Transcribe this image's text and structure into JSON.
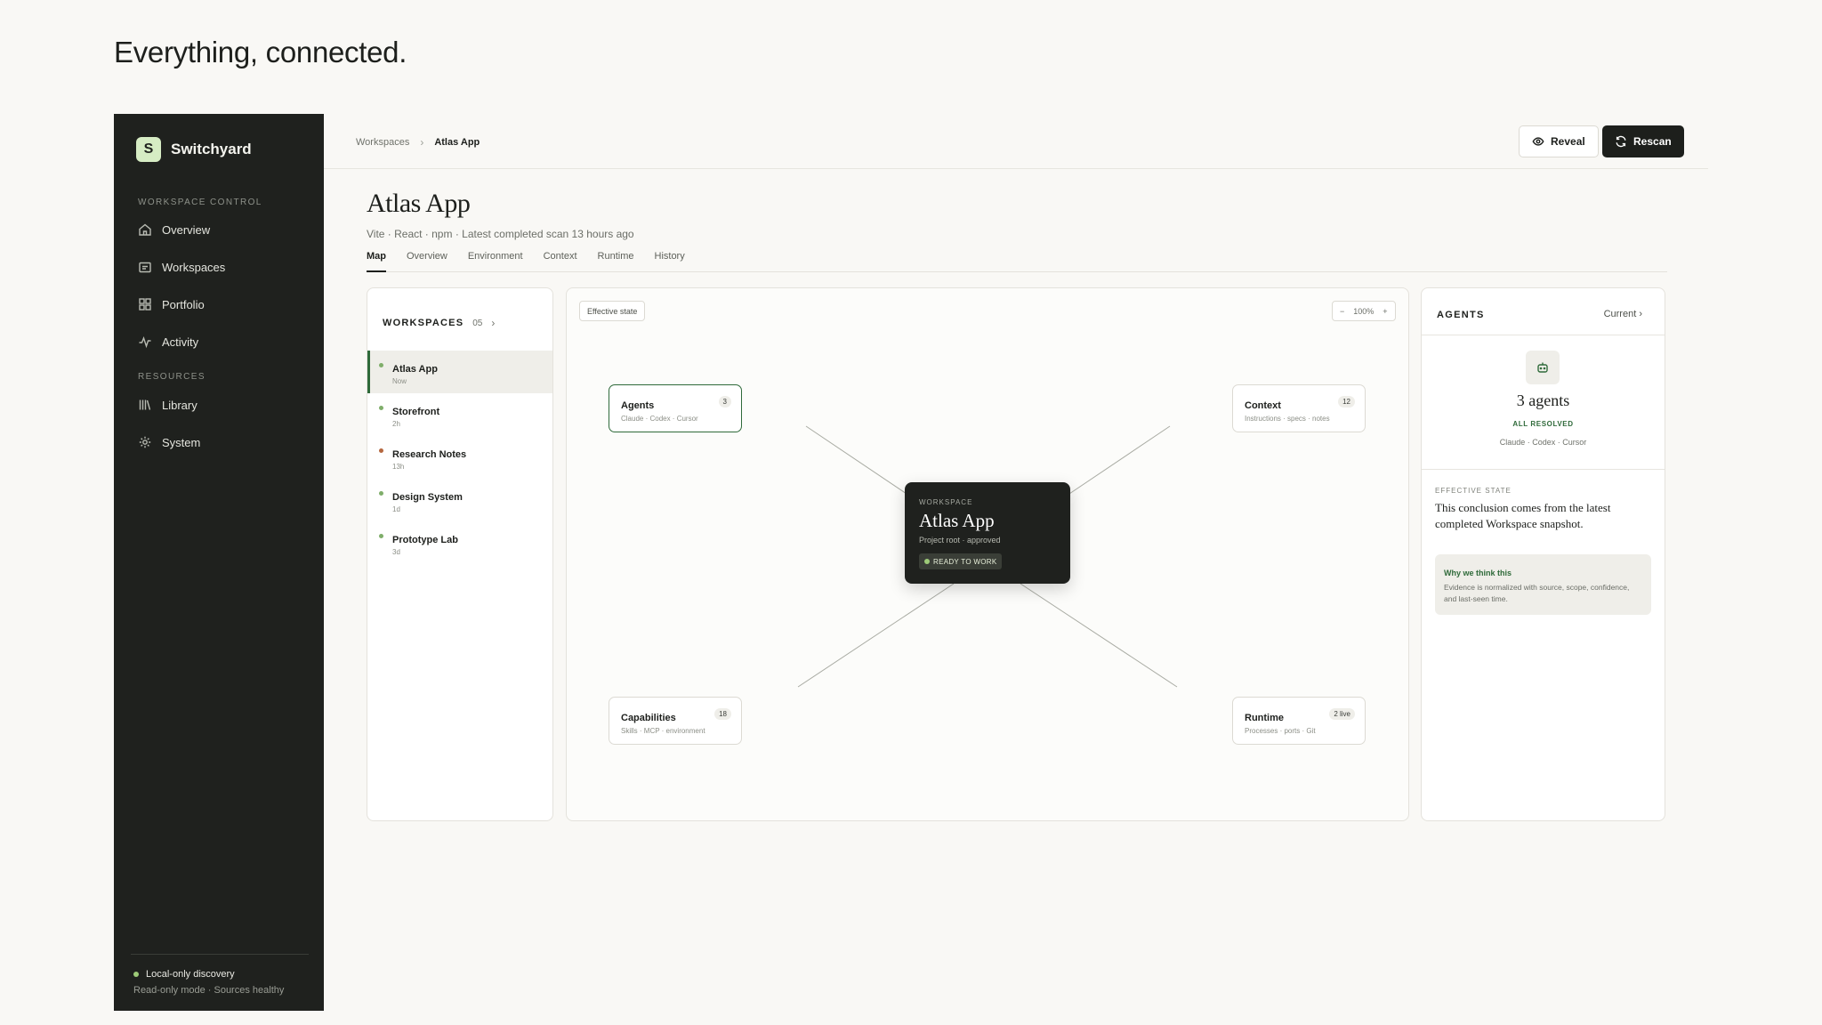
{
  "hero": {
    "title": "Everything, connected."
  },
  "sidebar": {
    "brand": {
      "logo_letter": "S",
      "name": "Switchyard"
    },
    "sections": [
      {
        "label": "WORKSPACE CONTROL",
        "items": [
          {
            "label": "Overview",
            "icon": "home-icon"
          },
          {
            "label": "Workspaces",
            "icon": "folder-icon"
          },
          {
            "label": "Portfolio",
            "icon": "grid-icon"
          },
          {
            "label": "Activity",
            "icon": "activity-icon"
          }
        ]
      },
      {
        "label": "RESOURCES",
        "items": [
          {
            "label": "Library",
            "icon": "library-icon"
          },
          {
            "label": "System",
            "icon": "gear-icon"
          }
        ]
      }
    ],
    "footer": {
      "title": "Local-only discovery",
      "subtitle": "Read-only mode · Sources healthy"
    }
  },
  "topbar": {
    "breadcrumb": [
      "Workspaces",
      "Atlas App"
    ],
    "reveal_label": "Reveal",
    "rescan_label": "Rescan"
  },
  "page": {
    "title": "Atlas App",
    "subtitle": "Vite · React · npm · Latest completed scan 13 hours ago",
    "tabs": [
      "Map",
      "Overview",
      "Environment",
      "Context",
      "Runtime",
      "History"
    ],
    "active_tab": "Map"
  },
  "workspaces": {
    "title": "WORKSPACES",
    "count": "05",
    "items": [
      {
        "name": "Atlas App",
        "time": "Now",
        "dot_color": "#7fae6a",
        "selected": true
      },
      {
        "name": "Storefront",
        "time": "2h",
        "dot_color": "#7fae6a"
      },
      {
        "name": "Research Notes",
        "time": "13h",
        "dot_color": "#b5673f"
      },
      {
        "name": "Design System",
        "time": "1d",
        "dot_color": "#7fae6a"
      },
      {
        "name": "Prototype Lab",
        "time": "3d",
        "dot_color": "#7fae6a"
      }
    ]
  },
  "map": {
    "state_chip": "Effective state",
    "zoom": {
      "minus": "−",
      "level": "100%",
      "plus": "+"
    },
    "center": {
      "label": "WORKSPACE",
      "title": "Atlas App",
      "subtitle": "Project root · approved",
      "badge": "READY TO WORK"
    },
    "nodes": {
      "agents": {
        "title": "Agents",
        "subtitle": "Claude · Codex · Cursor",
        "badge": "3"
      },
      "context": {
        "title": "Context",
        "subtitle": "Instructions · specs · notes",
        "badge": "12"
      },
      "capabilities": {
        "title": "Capabilities",
        "subtitle": "Skills · MCP · environment",
        "badge": "18"
      },
      "runtime": {
        "title": "Runtime",
        "subtitle": "Processes · ports · Git",
        "badge": "2 live"
      }
    }
  },
  "agents_panel": {
    "title": "AGENTS",
    "current": "Current",
    "count": "3 agents",
    "status": "ALL RESOLVED",
    "list": "Claude · Codex · Cursor",
    "effective_label": "EFFECTIVE STATE",
    "effective_text": "This conclusion comes from the latest completed Workspace snapshot.",
    "why_title": "Why we think this",
    "why_body": "Evidence is normalized with source, scope, confidence, and last-seen time."
  },
  "colors": {
    "accent": "#2f6a3a",
    "sidebar_bg": "#1f211e",
    "page_bg": "#f9f8f5"
  }
}
